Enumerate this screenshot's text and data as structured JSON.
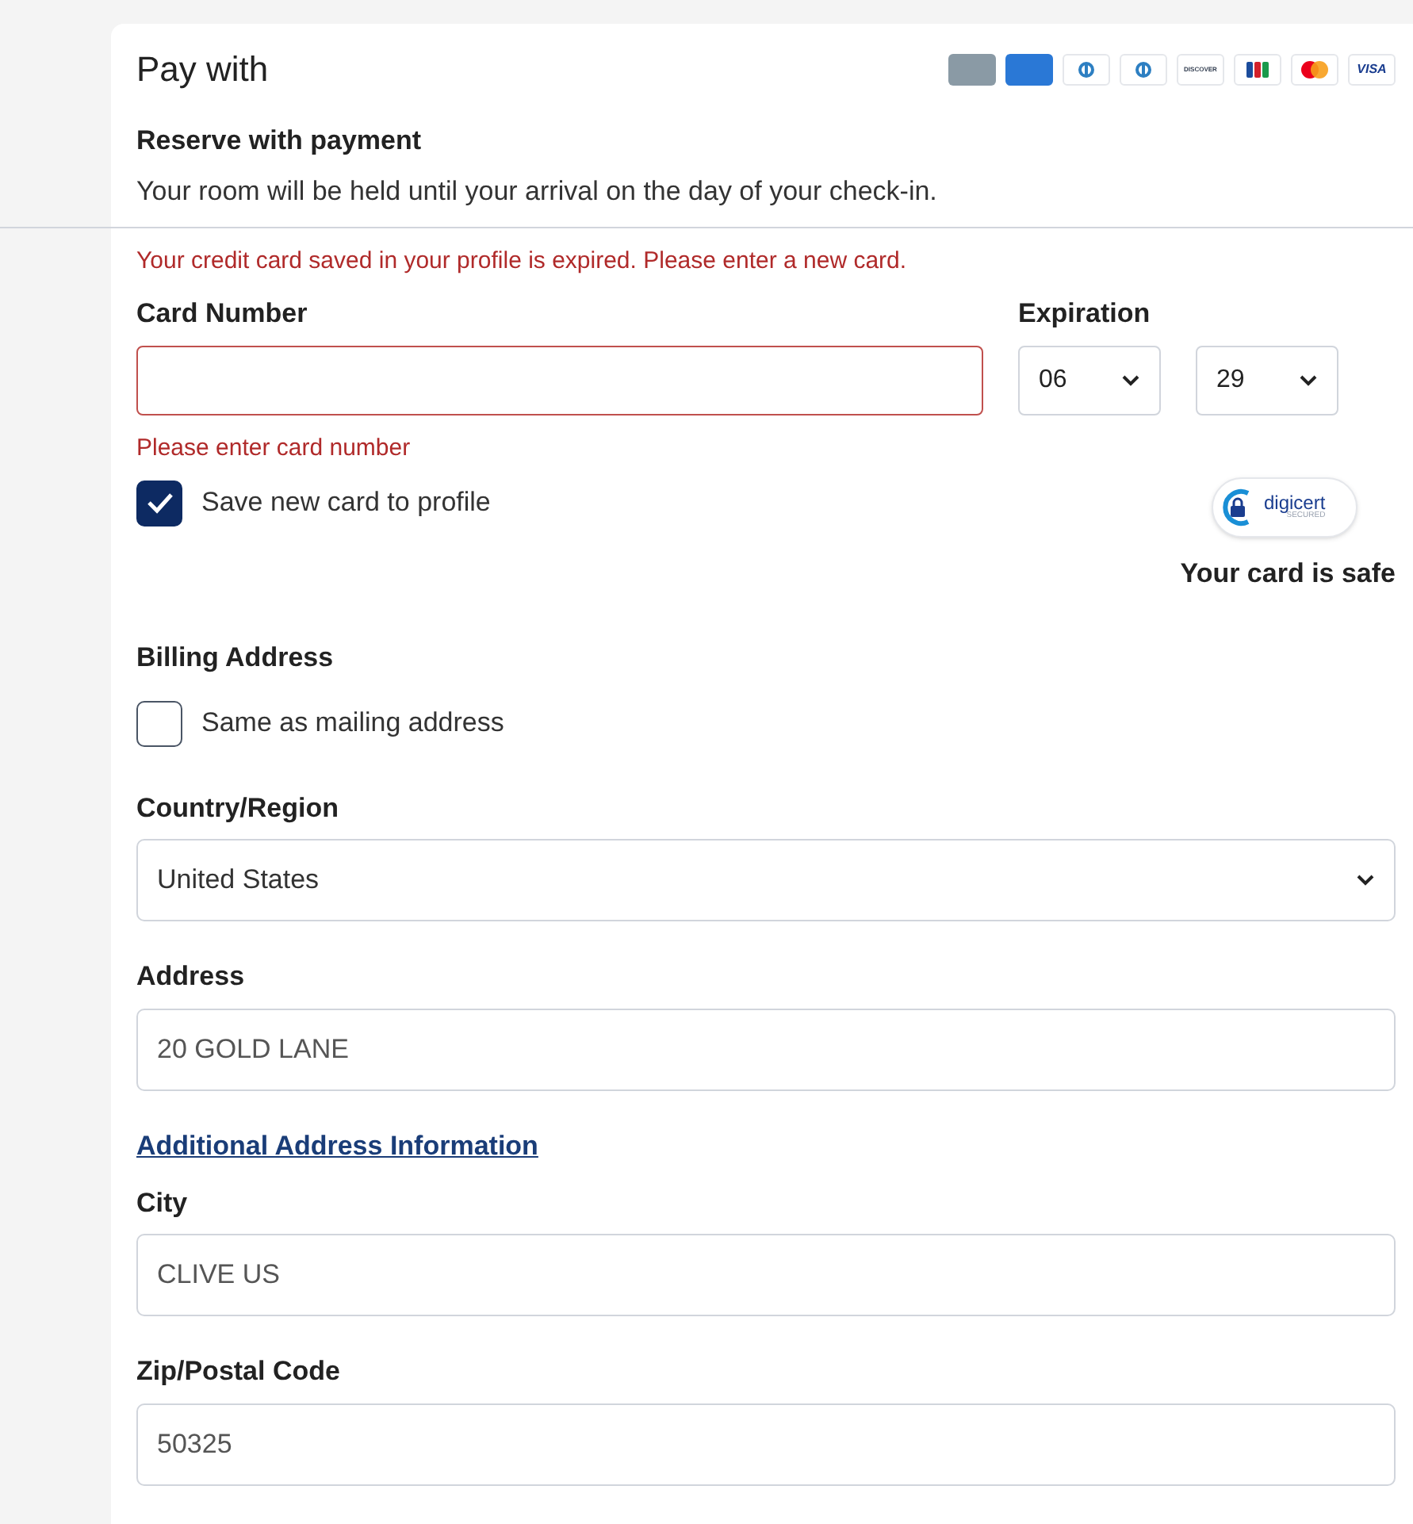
{
  "header": {
    "title": "Pay with",
    "card_logos": [
      {
        "kind": "generic"
      },
      {
        "kind": "amex"
      },
      {
        "kind": "diners"
      },
      {
        "kind": "diners"
      },
      {
        "kind": "discover",
        "text": "DISCOVER"
      },
      {
        "kind": "jcb"
      },
      {
        "kind": "mastercard"
      },
      {
        "kind": "visa",
        "text": "VISA"
      }
    ]
  },
  "reserve": {
    "title": "Reserve with payment",
    "text": "Your room will be held until your arrival on the day of your check-in."
  },
  "card": {
    "alert": "Your credit card saved in your profile is expired. Please enter a new card.",
    "number_label": "Card Number",
    "number_error": "Please enter card number",
    "expiration_label": "Expiration",
    "month": "06",
    "year": "29",
    "save_checkbox": {
      "label": "Save new card to profile",
      "checked": true
    },
    "seal": {
      "brand": "digicert",
      "sub": "SECURED"
    },
    "safe_text": "Your card is safe"
  },
  "billing": {
    "title": "Billing Address",
    "same_checkbox": {
      "label": "Same as mailing address",
      "checked": false
    },
    "fields": [
      {
        "kind": "select",
        "label": "Country/Region",
        "value": "United States"
      },
      {
        "kind": "input",
        "label": "Address",
        "value": "20 GOLD LANE"
      },
      {
        "kind": "link",
        "label": "Additional Address Information"
      },
      {
        "kind": "input",
        "label": "City",
        "value": "CLIVE US"
      },
      {
        "kind": "input",
        "label": "Zip/Postal Code",
        "value": "50325"
      }
    ]
  }
}
